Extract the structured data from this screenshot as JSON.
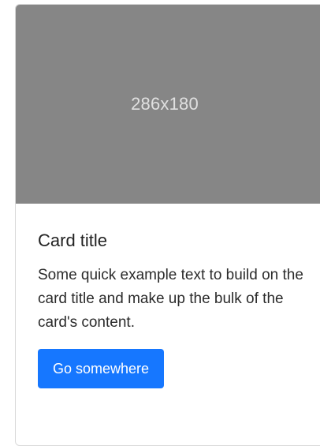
{
  "card": {
    "image": {
      "placeholder_text": "286x180",
      "background": "#868686"
    },
    "title": "Card title",
    "text": "Some quick example text to build on the card title and make up the bulk of the card's content.",
    "button": {
      "label": "Go somewhere",
      "color": "#1677ff"
    }
  }
}
